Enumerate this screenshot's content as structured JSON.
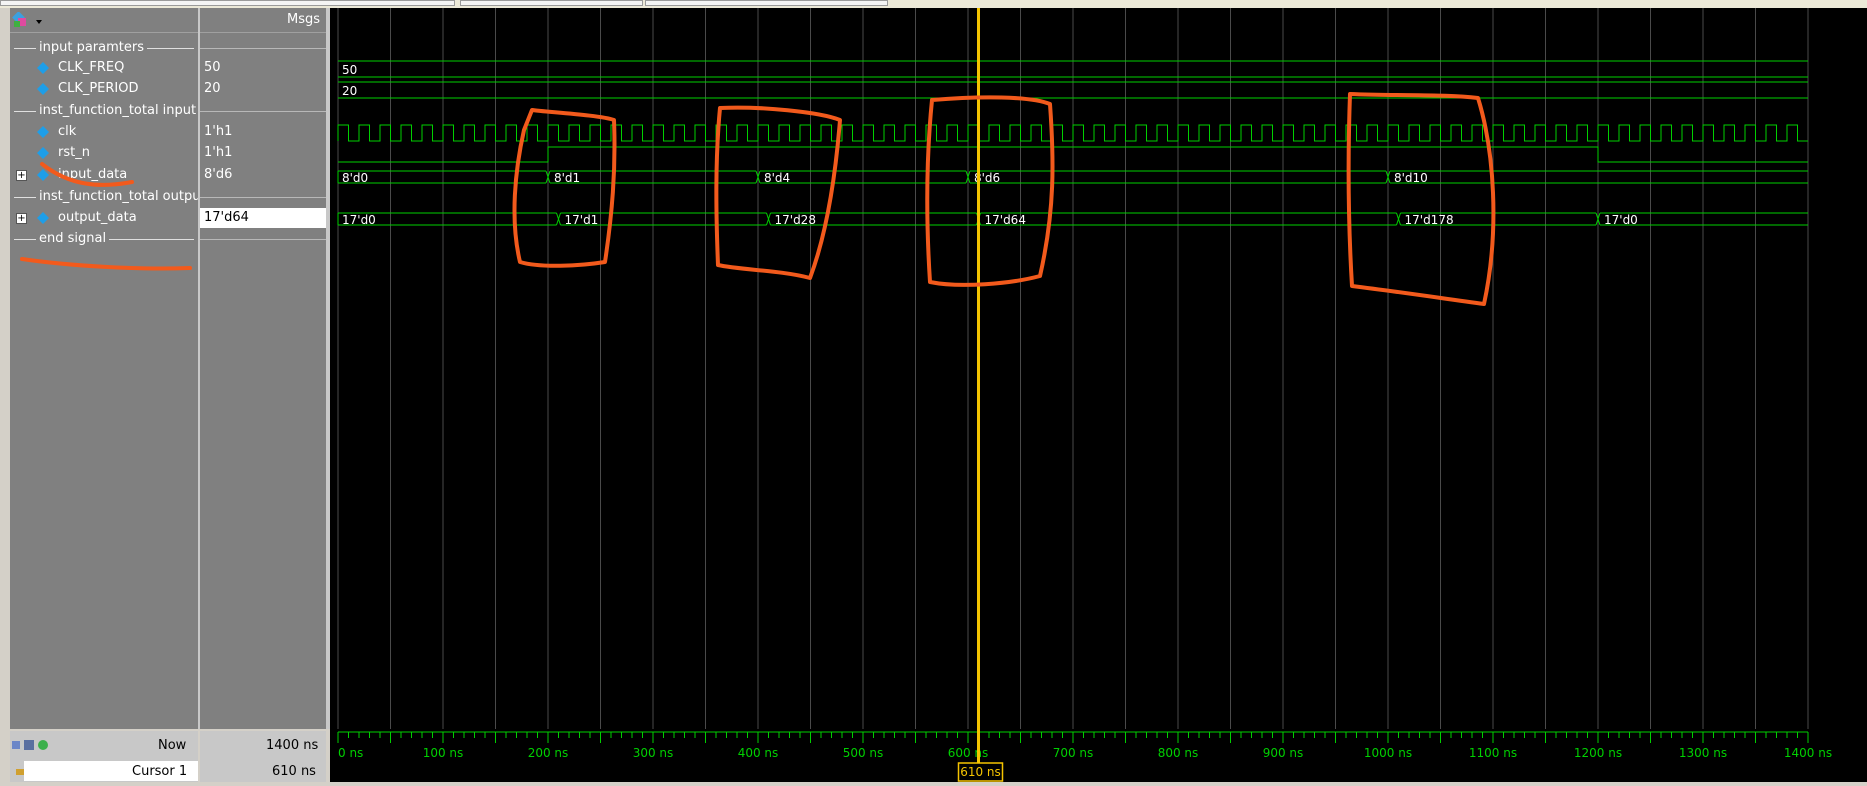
{
  "header": {
    "msgs_label": "Msgs"
  },
  "groups": {
    "input_params": "input paramters",
    "function_input": "inst_function_total input",
    "function_output": "inst_function_total output",
    "end_signal": "end signal"
  },
  "signals": [
    {
      "name": "CLK_FREQ",
      "value": "50"
    },
    {
      "name": "CLK_PERIOD",
      "value": "20"
    },
    {
      "name": "clk",
      "value": "1'h1"
    },
    {
      "name": "rst_n",
      "value": "1'h1"
    },
    {
      "name": "input_data",
      "value": "8'd6"
    },
    {
      "name": "output_data",
      "value": "17'd64"
    }
  ],
  "waveform": {
    "time_range_ns": [
      0,
      1400
    ],
    "clk_period_ns": 20,
    "rst_release_ns": 200,
    "rst_fall_ns": 1200,
    "cursor_ns": 610,
    "clk_freq_text": "50",
    "clk_period_text": "20",
    "input_segments": [
      {
        "t": 0,
        "label": "8'd0"
      },
      {
        "t": 200,
        "label": "8'd1"
      },
      {
        "t": 400,
        "label": "8'd4"
      },
      {
        "t": 600,
        "label": "8'd6"
      },
      {
        "t": 1000,
        "label": "8'd10"
      }
    ],
    "output_segments": [
      {
        "t": 0,
        "label": "17'd0"
      },
      {
        "t": 210,
        "label": "17'd1"
      },
      {
        "t": 410,
        "label": "17'd28"
      },
      {
        "t": 610,
        "label": "17'd64"
      },
      {
        "t": 1010,
        "label": "17'd178"
      },
      {
        "t": 1200,
        "label": "17'd0"
      }
    ],
    "axis_ticks": [
      "0 ns",
      "100 ns",
      "200 ns",
      "300 ns",
      "400 ns",
      "500 ns",
      "600 ns",
      "700 ns",
      "800 ns",
      "900 ns",
      "1000 ns",
      "1100 ns",
      "1200 ns",
      "1300 ns",
      "1400 ns"
    ],
    "colors": {
      "signal": "#00d000",
      "cursor": "#f5c400",
      "grid": "#4a4a4a",
      "annotation": "#f25a1c"
    }
  },
  "status": {
    "now_label": "Now",
    "now_value": "1400 ns",
    "cursor_label": "Cursor 1",
    "cursor_value": "610 ns",
    "cursor_marker": "610 ns"
  }
}
